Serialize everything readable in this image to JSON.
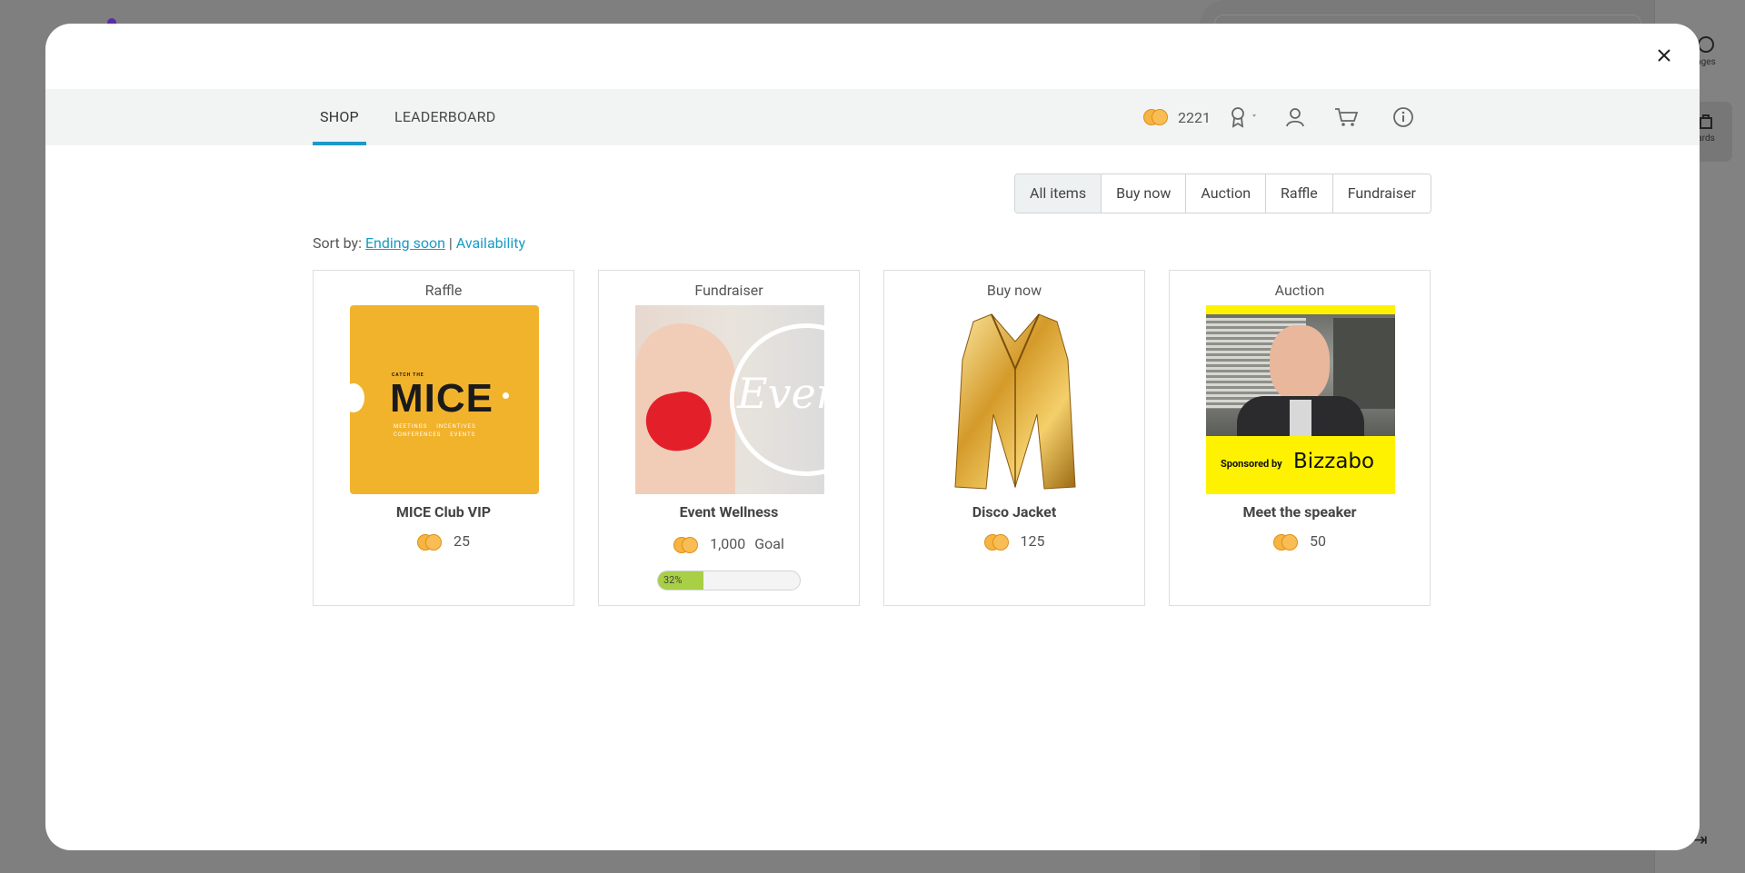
{
  "background": {
    "sidebar": {
      "messages_label": "ages",
      "rewards_label": "ards"
    }
  },
  "modal": {
    "tabs": [
      {
        "label": "SHOP",
        "active": true
      },
      {
        "label": "LEADERBOARD",
        "active": false
      }
    ],
    "balance": "2221",
    "icons": [
      "coin-icon",
      "badge-icon",
      "profile-icon",
      "cart-icon",
      "info-icon",
      "close-icon"
    ],
    "filters": [
      "All items",
      "Buy now",
      "Auction",
      "Raffle",
      "Fundraiser"
    ],
    "active_filter": "All items",
    "sort": {
      "label": "Sort by:",
      "ending_soon": "Ending soon",
      "separator": "|",
      "availability": "Availability"
    },
    "items": [
      {
        "type": "Raffle",
        "name": "MICE Club VIP",
        "price": "25",
        "image": "mice-logo",
        "image_text": {
          "top": "CATCH THE",
          "big": "MICE",
          "line1": "MEETINGS    INCENTIVES",
          "line2": "CONFERENCES    EVENTS"
        }
      },
      {
        "type": "Fundraiser",
        "name": "Event Wellness",
        "price": "1,000",
        "price_suffix": "Goal",
        "image": "heart-hands",
        "image_text": {
          "big": "Event"
        },
        "progress_label": "32%",
        "progress": 0.32
      },
      {
        "type": "Buy now",
        "name": "Disco Jacket",
        "price": "125",
        "image": "gold-jacket"
      },
      {
        "type": "Auction",
        "name": "Meet the speaker",
        "price": "50",
        "image": "speaker-photo",
        "image_text": {
          "sponsor": "Sponsored by",
          "brand": "Bizzabo"
        }
      }
    ]
  },
  "colors": {
    "accent": "#1a9ac7",
    "coin": "#f6b442",
    "progress": "#a8cf45",
    "mice_bg": "#f2b32c",
    "sponsor_bg": "#fff200"
  }
}
